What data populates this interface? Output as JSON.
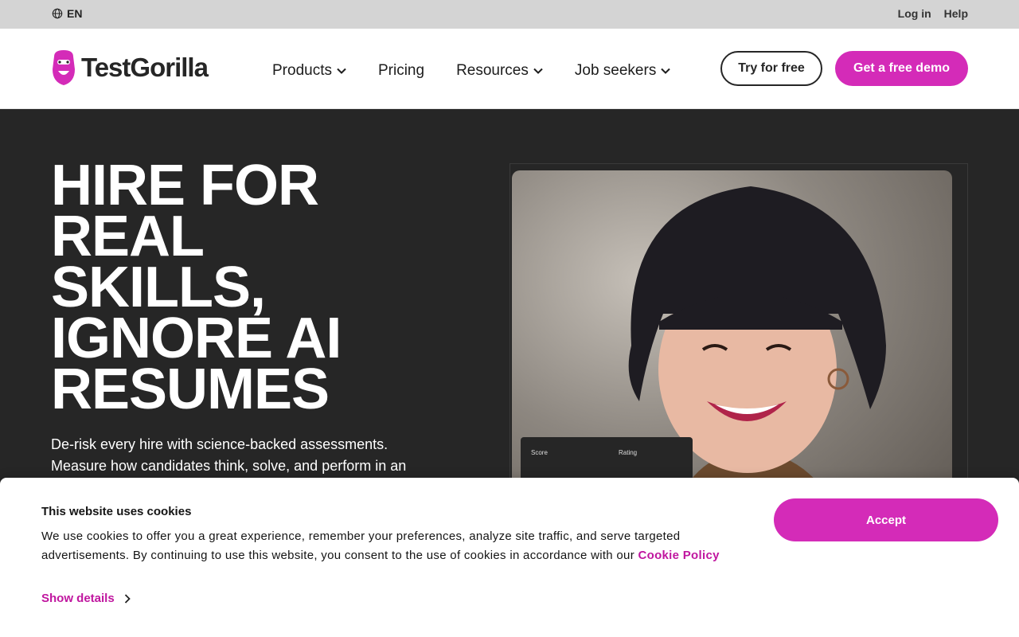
{
  "topbar": {
    "language": "EN",
    "links": [
      "Log in",
      "Help"
    ]
  },
  "nav": {
    "brand": "TestGorilla",
    "menu": [
      {
        "label": "Products",
        "has_dropdown": true
      },
      {
        "label": "Pricing",
        "has_dropdown": false
      },
      {
        "label": "Resources",
        "has_dropdown": true
      },
      {
        "label": "Job seekers",
        "has_dropdown": true
      }
    ],
    "try_free": "Try for free",
    "demo": "Get a free demo"
  },
  "hero": {
    "headline_lines": [
      "HIRE FOR",
      "REAL",
      "SKILLS,",
      "IGNORE AI",
      "RESUMES"
    ],
    "subtext": "De-risk every hire with science-backed assessments. Measure how candidates think, solve, and perform in an",
    "score_card": {
      "score_label": "Score",
      "rating_label": "Rating"
    }
  },
  "cookie": {
    "title": "This website uses cookies",
    "text": "We use cookies to offer you a great experience, remember your preferences, analyze site traffic, and serve targeted advertisements. By continuing to use this website, you consent to the use of cookies in accordance with our ",
    "policy_link": "Cookie Policy",
    "show_details": "Show details",
    "accept": "Accept"
  },
  "colors": {
    "brand_pink": "#d42bb8",
    "link_pink": "#c0169f",
    "dark_bg": "#262626",
    "topbar_bg": "#d4d4d4"
  }
}
